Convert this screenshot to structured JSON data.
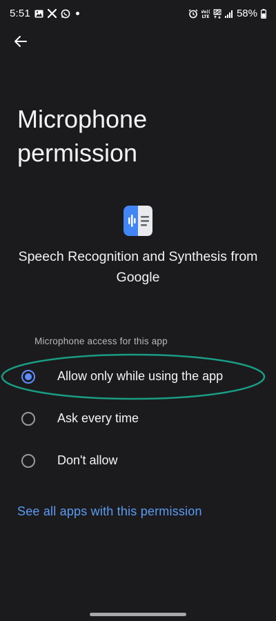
{
  "status_bar": {
    "time": "5:51",
    "volte_label": "Vo))\nLTE",
    "net_label": "5G",
    "battery": "58%",
    "left_icons": [
      "gallery-icon",
      "x-app-icon",
      "whatsapp-icon",
      "notification-dot"
    ],
    "right_icons": [
      "alarm-icon",
      "volte-icon",
      "5g-icon",
      "signal-icon",
      "battery-icon"
    ]
  },
  "header": {
    "back_icon": "arrow-left-icon",
    "title": "Microphone permission"
  },
  "app": {
    "icon": "speech-services-icon",
    "name": "Speech Recognition and Synthesis from Google"
  },
  "permission": {
    "section_label": "Microphone access for this app",
    "options": [
      {
        "label": "Allow only while using the app",
        "selected": true
      },
      {
        "label": "Ask every time",
        "selected": false
      },
      {
        "label": "Don't allow",
        "selected": false
      }
    ]
  },
  "link": {
    "see_all": "See all apps with this permission"
  },
  "colors": {
    "background": "#1b1b1d",
    "accent": "#5f8cff",
    "link": "#5b9bf3",
    "annotation": "#1a9d85"
  }
}
